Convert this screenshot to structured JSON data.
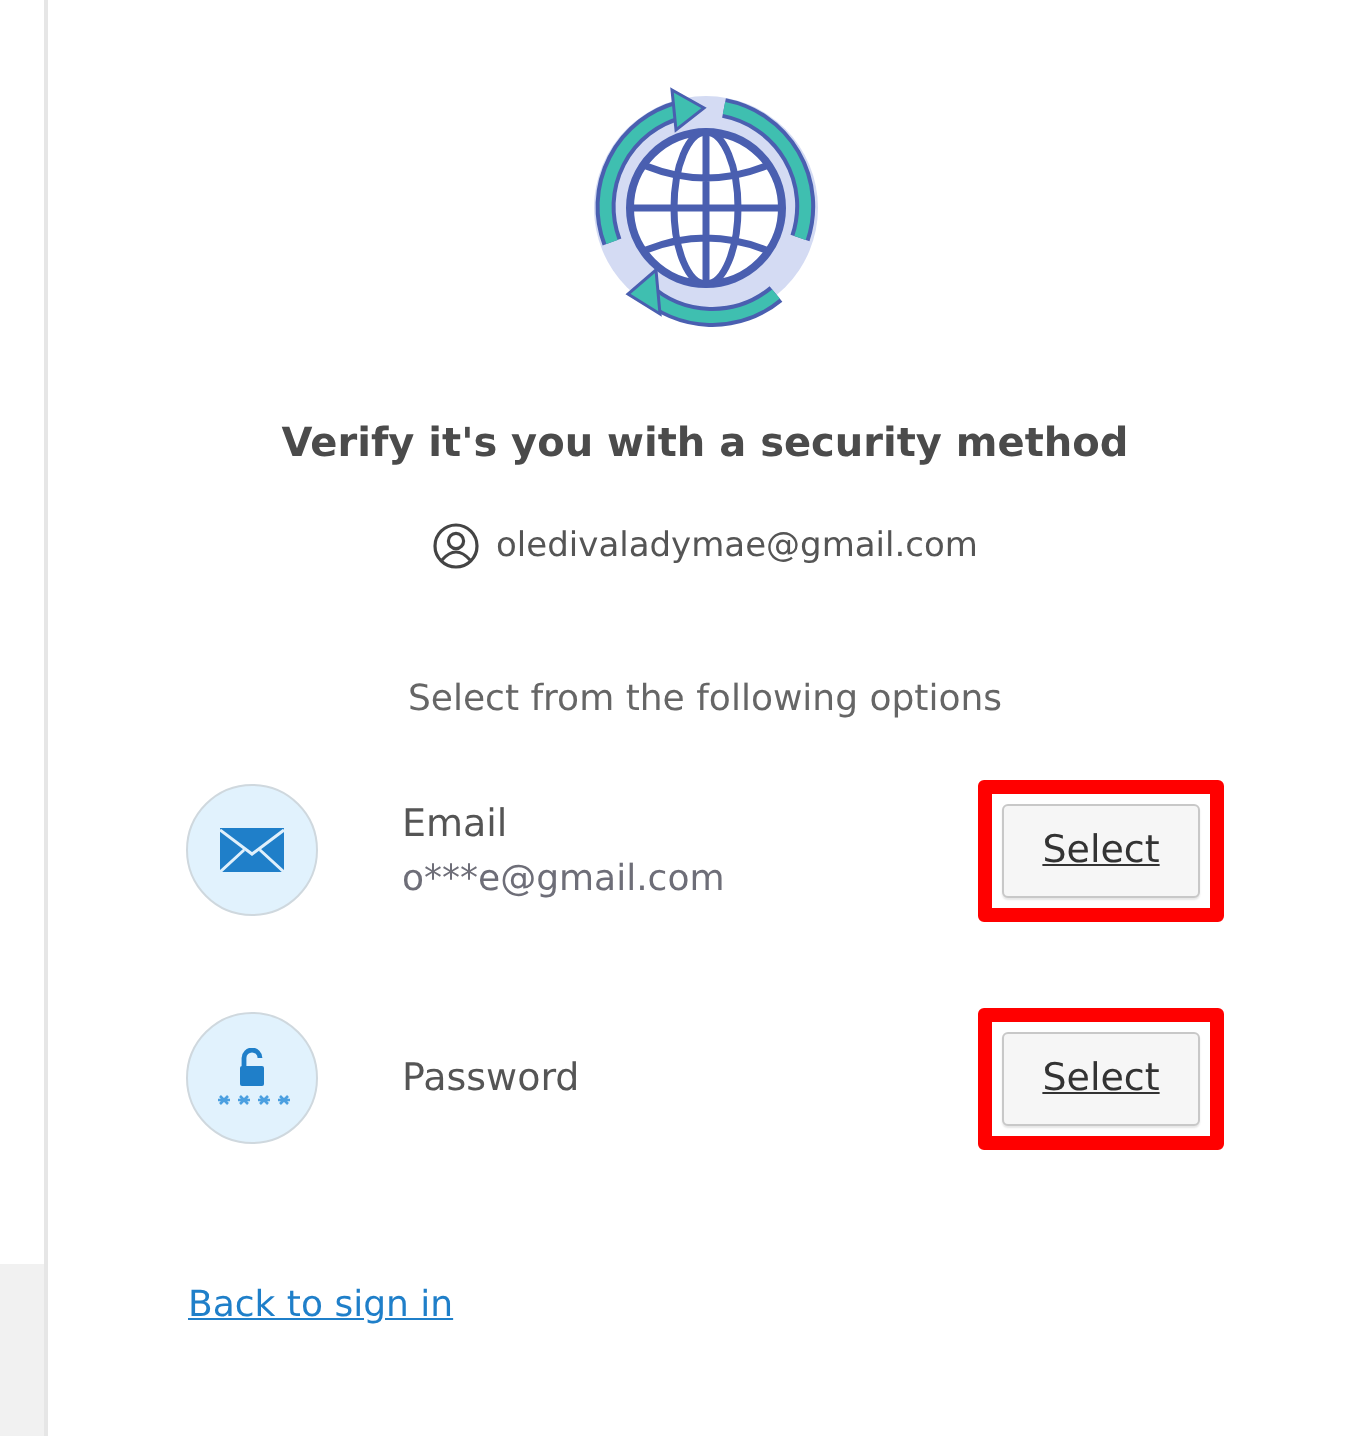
{
  "title": "Verify it's you with a security method",
  "account": "oledivaladymae@gmail.com",
  "prompt": "Select from the following options",
  "options": [
    {
      "kind": "email",
      "label": "Email",
      "detail": "o***e@gmail.com",
      "button": "Select",
      "highlighted": true
    },
    {
      "kind": "password",
      "label": "Password",
      "button": "Select",
      "highlighted": true
    }
  ],
  "back_link": "Back to sign in"
}
